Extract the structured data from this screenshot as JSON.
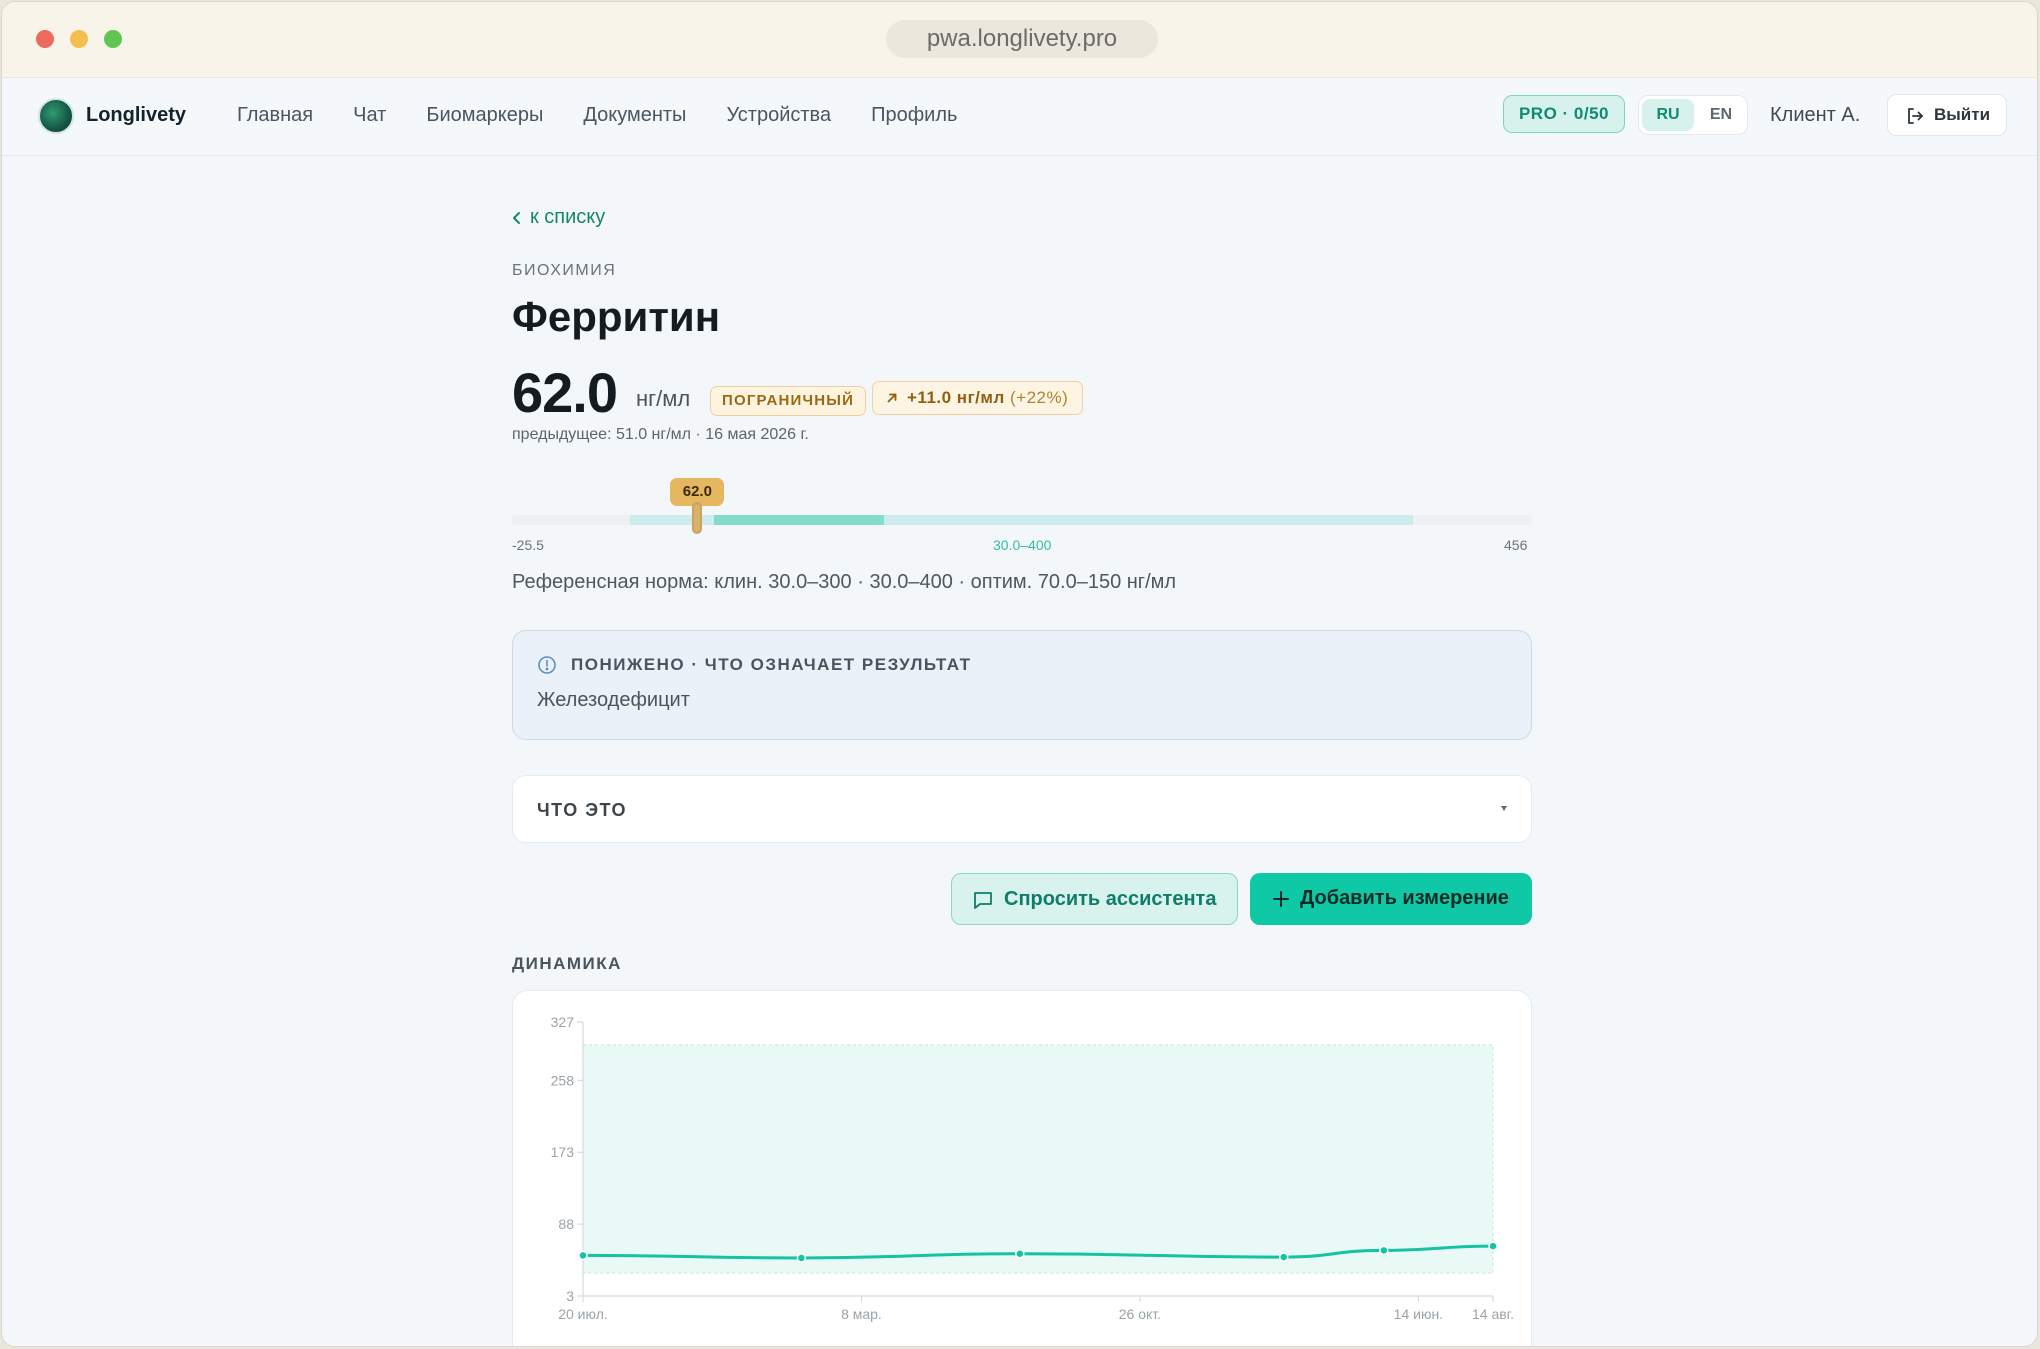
{
  "browser": {
    "url": "pwa.longlivety.pro"
  },
  "nav": {
    "brand": "Longlivety",
    "links": [
      "Главная",
      "Чат",
      "Биомаркеры",
      "Документы",
      "Устройства",
      "Профиль"
    ],
    "pro_badge": "PRO · 0/50",
    "lang_ru": "RU",
    "lang_en": "EN",
    "client": "Клиент А.",
    "logout": "Выйти"
  },
  "page": {
    "back": "к списку",
    "category": "БИОХИМИЯ",
    "title": "Ферритин",
    "value": "62.0",
    "unit": "нг/мл",
    "status_badge": "ПОГРАНИЧНЫЙ",
    "delta": "+11.0 нг/мл",
    "delta_pct": "(+22%)",
    "previous": "предыдущее: 51.0 нг/мл · 16 мая 2026 г.",
    "colors": {
      "accent": "#0ec8a6",
      "borderline": "#e5b760"
    }
  },
  "range": {
    "marker_label": "62.0",
    "min_label": "-25.5",
    "mid_label": "30.0–400",
    "max_label": "456",
    "scale_min": -25.5,
    "scale_max": 456,
    "value": 62.0,
    "clin_low": 30.0,
    "clin_high": 400,
    "opt_low": 70.0,
    "opt_high": 150,
    "refnorm": "Референсная норма: клин. 30.0–300 · 30.0–400 · оптим. 70.0–150 нг/мл"
  },
  "alert": {
    "icon": "info-circle-icon",
    "title": "ПОНИЖЕНО · ЧТО ОЗНАЧАЕТ РЕЗУЛЬТАТ",
    "text": "Железодефицит"
  },
  "accordion": {
    "title": "ЧТО ЭТО"
  },
  "actions": {
    "ask": "Спросить ассистента",
    "add": "Добавить измерение"
  },
  "dynamics": {
    "title": "ДИНАМИКА"
  },
  "chart_data": {
    "type": "line",
    "ylim": [
      3,
      327
    ],
    "yticks": [
      3,
      88,
      173,
      258,
      327
    ],
    "xtick_labels": [
      "20 июл.",
      "8 мар.",
      "26 окт.",
      "14 июн.",
      "14 авг."
    ],
    "xtick_pos": [
      0,
      0.306,
      0.612,
      0.918,
      1.0
    ],
    "reference_band": [
      30,
      300
    ],
    "x": [
      0,
      0.24,
      0.48,
      0.77,
      0.88,
      1.0
    ],
    "values": [
      51,
      48,
      53,
      49,
      57,
      62
    ]
  }
}
